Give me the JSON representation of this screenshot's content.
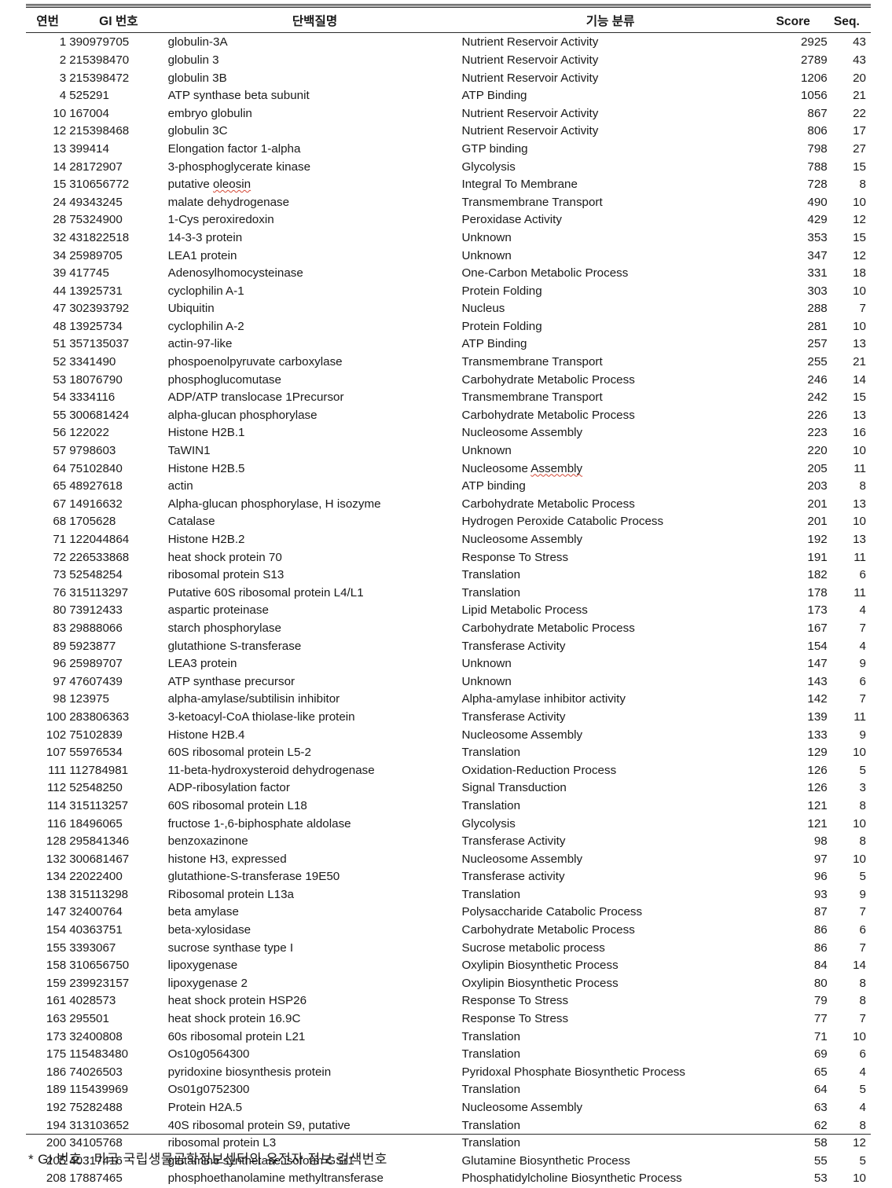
{
  "table": {
    "headers": {
      "no": "연번",
      "gi": "GI 번호",
      "protein": "단백질명",
      "function": "기능 분류",
      "score": "Score",
      "seq": "Seq."
    },
    "rows": [
      {
        "no": "1",
        "gi": "390979705",
        "protein": "globulin-3A",
        "function": "Nutrient Reservoir  Activity",
        "score": "2925",
        "seq": "43"
      },
      {
        "no": "2",
        "gi": "215398470",
        "protein": "globulin 3",
        "function": "Nutrient Reservoir  Activity",
        "score": "2789",
        "seq": "43"
      },
      {
        "no": "3",
        "gi": "215398472",
        "protein": "globulin 3B",
        "function": "Nutrient Reservoir  Activity",
        "score": "1206",
        "seq": "20"
      },
      {
        "no": "4",
        "gi": "525291",
        "protein": "ATP synthase beta subunit",
        "function": "ATP Binding",
        "score": "1056",
        "seq": "21"
      },
      {
        "no": "10",
        "gi": "167004",
        "protein": "embryo globulin",
        "function": "Nutrient Reservoir  Activity",
        "score": "867",
        "seq": "22"
      },
      {
        "no": "12",
        "gi": "215398468",
        "protein": "globulin 3C",
        "function": "Nutrient Reservoir  Activity",
        "score": "806",
        "seq": "17"
      },
      {
        "no": "13",
        "gi": "399414",
        "protein": "Elongation factor 1-alpha",
        "function": "GTP binding",
        "score": "798",
        "seq": "27"
      },
      {
        "no": "14",
        "gi": "28172907",
        "protein": "3-phosphoglycerate kinase",
        "function": "Glycolysis",
        "score": "788",
        "seq": "15"
      },
      {
        "no": "15",
        "gi": "310656772",
        "protein": "putative oleosin",
        "function": "Integral To  Membrane",
        "score": "728",
        "seq": "8",
        "protein_spell": true
      },
      {
        "no": "24",
        "gi": "49343245",
        "protein": "malate dehydrogenase",
        "function": "Transmembrane Transport",
        "score": "490",
        "seq": "10"
      },
      {
        "no": "28",
        "gi": "75324900",
        "protein": "1-Cys peroxiredoxin",
        "function": "Peroxidase Activity",
        "score": "429",
        "seq": "12"
      },
      {
        "no": "32",
        "gi": "431822518",
        "protein": "14-3-3 protein",
        "function": "Unknown",
        "score": "353",
        "seq": "15"
      },
      {
        "no": "34",
        "gi": "25989705",
        "protein": "LEA1 protein",
        "function": "Unknown",
        "score": "347",
        "seq": "12"
      },
      {
        "no": "39",
        "gi": "417745",
        "protein": "Adenosylhomocysteinase",
        "function": "One-Carbon Metabolic Process",
        "score": "331",
        "seq": "18"
      },
      {
        "no": "44",
        "gi": "13925731",
        "protein": "cyclophilin A-1",
        "function": "Protein Folding",
        "score": "303",
        "seq": "10"
      },
      {
        "no": "47",
        "gi": "302393792",
        "protein": "Ubiquitin",
        "function": "Nucleus",
        "score": "288",
        "seq": "7"
      },
      {
        "no": "48",
        "gi": "13925734",
        "protein": "cyclophilin A-2",
        "function": "Protein Folding",
        "score": "281",
        "seq": "10"
      },
      {
        "no": "51",
        "gi": "357135037",
        "protein": "actin-97-like",
        "function": "ATP Binding",
        "score": "257",
        "seq": "13"
      },
      {
        "no": "52",
        "gi": "3341490",
        "protein": "phospoenolpyruvate carboxylase",
        "function": "Transmembrane Transport",
        "score": "255",
        "seq": "21"
      },
      {
        "no": "53",
        "gi": "18076790",
        "protein": "phosphoglucomutase",
        "function": "Carbohydrate Metabolic Process",
        "score": "246",
        "seq": "14"
      },
      {
        "no": "54",
        "gi": "3334116",
        "protein": "ADP/ATP translocase 1Precursor",
        "function": "Transmembrane Transport",
        "score": "242",
        "seq": "15"
      },
      {
        "no": "55",
        "gi": "300681424",
        "protein": "alpha-glucan phosphorylase",
        "function": "Carbohydrate Metabolic Process",
        "score": "226",
        "seq": "13"
      },
      {
        "no": "56",
        "gi": "122022",
        "protein": "Histone H2B.1",
        "function": "Nucleosome Assembly",
        "score": "223",
        "seq": "16"
      },
      {
        "no": "57",
        "gi": "9798603",
        "protein": "TaWIN1",
        "function": "Unknown",
        "score": "220",
        "seq": "10"
      },
      {
        "no": "64",
        "gi": "75102840",
        "protein": "Histone H2B.5",
        "function": "Nucleosome Assembly",
        "score": "205",
        "seq": "11",
        "function_spell": true
      },
      {
        "no": "65",
        "gi": "48927618",
        "protein": "actin",
        "function": "ATP binding",
        "score": "203",
        "seq": "8"
      },
      {
        "no": "67",
        "gi": "14916632",
        "protein": "Alpha-glucan phosphorylase, H isozyme",
        "function": "Carbohydrate Metabolic Process",
        "score": "201",
        "seq": "13"
      },
      {
        "no": "68",
        "gi": "1705628",
        "protein": "Catalase",
        "function": "Hydrogen Peroxide Catabolic Process",
        "score": "201",
        "seq": "10"
      },
      {
        "no": "71",
        "gi": "122044864",
        "protein": "Histone H2B.2",
        "function": "Nucleosome Assembly",
        "score": "192",
        "seq": "13"
      },
      {
        "no": "72",
        "gi": "226533868",
        "protein": "heat shock protein  70",
        "function": "Response To Stress",
        "score": "191",
        "seq": "11"
      },
      {
        "no": "73",
        "gi": "52548254",
        "protein": "ribosomal protein S13",
        "function": "Translation",
        "score": "182",
        "seq": "6"
      },
      {
        "no": "76",
        "gi": "315113297",
        "protein": "Putative 60S ribosomal protein L4/L1",
        "function": "Translation",
        "score": "178",
        "seq": "11"
      },
      {
        "no": "80",
        "gi": "73912433",
        "protein": "aspartic proteinase",
        "function": "Lipid Metabolic Process",
        "score": "173",
        "seq": "4"
      },
      {
        "no": "83",
        "gi": "29888066",
        "protein": "starch phosphorylase",
        "function": "Carbohydrate Metabolic Process",
        "score": "167",
        "seq": "7"
      },
      {
        "no": "89",
        "gi": "5923877",
        "protein": "glutathione S-transferase",
        "function": "Transferase Activity",
        "score": "154",
        "seq": "4"
      },
      {
        "no": "96",
        "gi": "25989707",
        "protein": "LEA3 protein",
        "function": "Unknown",
        "score": "147",
        "seq": "9"
      },
      {
        "no": "97",
        "gi": "47607439",
        "protein": "ATP synthase precursor",
        "function": "Unknown",
        "score": "143",
        "seq": "6"
      },
      {
        "no": "98",
        "gi": "123975",
        "protein": "alpha-amylase/subtilisin inhibitor",
        "function": "Alpha-amylase inhibitor activity",
        "score": "142",
        "seq": "7"
      },
      {
        "no": "100",
        "gi": "283806363",
        "protein": "3-ketoacyl-CoA thiolase-like protein",
        "function": "Transferase Activity",
        "score": "139",
        "seq": "11"
      },
      {
        "no": "102",
        "gi": "75102839",
        "protein": "Histone H2B.4",
        "function": "Nucleosome Assembly",
        "score": "133",
        "seq": "9"
      },
      {
        "no": "107",
        "gi": "55976534",
        "protein": "60S ribosomal protein L5-2",
        "function": "Translation",
        "score": "129",
        "seq": "10"
      },
      {
        "no": "111",
        "gi": "112784981",
        "protein": "11-beta-hydroxysteroid dehydrogenase",
        "function": "Oxidation-Reduction Process",
        "score": "126",
        "seq": "5"
      },
      {
        "no": "112",
        "gi": "52548250",
        "protein": "ADP-ribosylation factor",
        "function": "Signal Transduction",
        "score": "126",
        "seq": "3"
      },
      {
        "no": "114",
        "gi": "315113257",
        "protein": "60S ribosomal protein L18",
        "function": "Translation",
        "score": "121",
        "seq": "8"
      },
      {
        "no": "116",
        "gi": "18496065",
        "protein": "fructose 1-,6-biphosphate aldolase",
        "function": "Glycolysis",
        "score": "121",
        "seq": "10"
      },
      {
        "no": "128",
        "gi": "295841346",
        "protein": "benzoxazinone",
        "function": "Transferase Activity",
        "score": "98",
        "seq": "8"
      },
      {
        "no": "132",
        "gi": "300681467",
        "protein": "histone H3, expressed",
        "function": "Nucleosome Assembly",
        "score": "97",
        "seq": "10"
      },
      {
        "no": "134",
        "gi": "22022400",
        "protein": "glutathione-S-transferase 19E50",
        "function": "Transferase activity",
        "score": "96",
        "seq": "5"
      },
      {
        "no": "138",
        "gi": "315113298",
        "protein": "Ribosomal protein L13a",
        "function": "Translation",
        "score": "93",
        "seq": "9"
      },
      {
        "no": "147",
        "gi": "32400764",
        "protein": "beta amylase",
        "function": "Polysaccharide Catabolic Process",
        "score": "87",
        "seq": "7"
      },
      {
        "no": "154",
        "gi": "40363751",
        "protein": "beta-xylosidase",
        "function": "Carbohydrate Metabolic Process",
        "score": "86",
        "seq": "6"
      },
      {
        "no": "155",
        "gi": "3393067",
        "protein": "sucrose synthase type I",
        "function": "Sucrose metabolic process",
        "score": "86",
        "seq": "7"
      },
      {
        "no": "158",
        "gi": "310656750",
        "protein": "lipoxygenase",
        "function": "Oxylipin Biosynthetic Process",
        "score": "84",
        "seq": "14"
      },
      {
        "no": "159",
        "gi": "239923157",
        "protein": "lipoxygenase 2",
        "function": "Oxylipin Biosynthetic Process",
        "score": "80",
        "seq": "8"
      },
      {
        "no": "161",
        "gi": "4028573",
        "protein": "heat shock protein  HSP26",
        "function": "Response To Stress",
        "score": "79",
        "seq": "8"
      },
      {
        "no": "163",
        "gi": "295501",
        "protein": "heat shock protein  16.9C",
        "function": "Response To Stress",
        "score": "77",
        "seq": "7"
      },
      {
        "no": "173",
        "gi": "32400808",
        "protein": "60s ribosomal protein L21",
        "function": "Translation",
        "score": "71",
        "seq": "10"
      },
      {
        "no": "175",
        "gi": "115483480",
        "protein": "Os10g0564300",
        "function": "Translation",
        "score": "69",
        "seq": "6"
      },
      {
        "no": "186",
        "gi": "74026503",
        "protein": "pyridoxine biosynthesis protein",
        "function": "Pyridoxal Phosphate Biosynthetic Process",
        "score": "65",
        "seq": "4"
      },
      {
        "no": "189",
        "gi": "115439969",
        "protein": "Os01g0752300",
        "function": "Translation",
        "score": "64",
        "seq": "5"
      },
      {
        "no": "192",
        "gi": "75282488",
        "protein": "Protein H2A.5",
        "function": "Nucleosome Assembly",
        "score": "63",
        "seq": "4"
      },
      {
        "no": "194",
        "gi": "313103652",
        "protein": "40S ribosomal protein S9, putative",
        "function": "Translation",
        "score": "62",
        "seq": "8"
      },
      {
        "no": "200",
        "gi": "34105768",
        "protein": "ribosomal protein L3",
        "function": "Translation",
        "score": "58",
        "seq": "12"
      },
      {
        "no": "205",
        "gi": "40317416",
        "protein": "glutamine synthetase isoform GSr1",
        "function": "Glutamine Biosynthetic Process",
        "score": "55",
        "seq": "5"
      },
      {
        "no": "208",
        "gi": "17887465",
        "protein": "phosphoethanolamine methyltransferase",
        "function": "Phosphatidylcholine Biosynthetic Process",
        "score": "53",
        "seq": "10"
      }
    ]
  },
  "footnote": "* GI 번호 : 미국 국립생물공학정보센터의 유전자 정보 검색번호"
}
